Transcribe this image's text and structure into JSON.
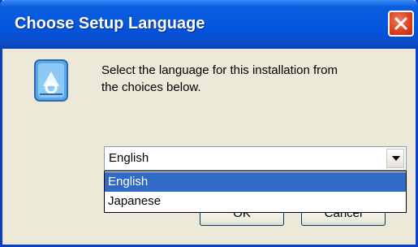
{
  "window": {
    "title": "Choose Setup Language",
    "close_icon": "close-icon"
  },
  "prompt": {
    "line1": "Select the language for this installation from",
    "line2": "the choices below."
  },
  "language_select": {
    "value": "English",
    "options": [
      "English",
      "Japanese"
    ],
    "selected_index": 0
  },
  "buttons": {
    "ok_label": "OK",
    "cancel_label": "Cancel"
  },
  "colors": {
    "titlebar": "#0454dc",
    "selection": "#316ac5",
    "close_button": "#e04020"
  }
}
